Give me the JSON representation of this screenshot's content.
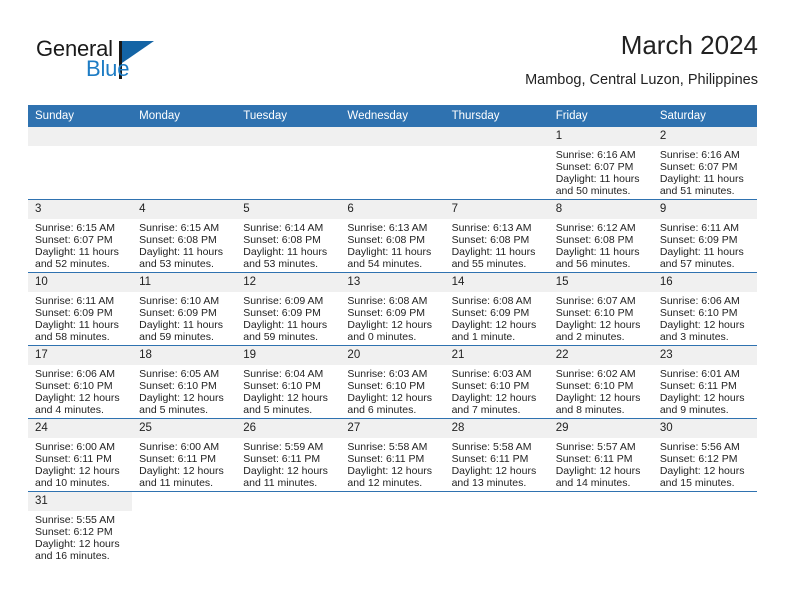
{
  "brand": {
    "name_part1": "General",
    "name_part2": "Blue",
    "triangle_color": "#1464a5",
    "blue_color": "#1d7cc4"
  },
  "header": {
    "title": "March 2024",
    "subtitle": "Mambog, Central Luzon, Philippines"
  },
  "theme": {
    "header_blue": "#2f72b0",
    "daynum_bg": "#f0f0f0",
    "text": "#232323"
  },
  "calendar": {
    "weekday_headers": [
      "Sunday",
      "Monday",
      "Tuesday",
      "Wednesday",
      "Thursday",
      "Friday",
      "Saturday"
    ],
    "weeks": [
      [
        {
          "day": "",
          "kind": "blank"
        },
        {
          "day": "",
          "kind": "blank"
        },
        {
          "day": "",
          "kind": "blank"
        },
        {
          "day": "",
          "kind": "blank"
        },
        {
          "day": "",
          "kind": "blank"
        },
        {
          "day": "1",
          "kind": "day",
          "sunrise": "Sunrise: 6:16 AM",
          "sunset": "Sunset: 6:07 PM",
          "daylight_line1": "Daylight: 11 hours",
          "daylight_line2": "and 50 minutes."
        },
        {
          "day": "2",
          "kind": "day",
          "sunrise": "Sunrise: 6:16 AM",
          "sunset": "Sunset: 6:07 PM",
          "daylight_line1": "Daylight: 11 hours",
          "daylight_line2": "and 51 minutes."
        }
      ],
      [
        {
          "day": "3",
          "kind": "day",
          "sunrise": "Sunrise: 6:15 AM",
          "sunset": "Sunset: 6:07 PM",
          "daylight_line1": "Daylight: 11 hours",
          "daylight_line2": "and 52 minutes."
        },
        {
          "day": "4",
          "kind": "day",
          "sunrise": "Sunrise: 6:15 AM",
          "sunset": "Sunset: 6:08 PM",
          "daylight_line1": "Daylight: 11 hours",
          "daylight_line2": "and 53 minutes."
        },
        {
          "day": "5",
          "kind": "day",
          "sunrise": "Sunrise: 6:14 AM",
          "sunset": "Sunset: 6:08 PM",
          "daylight_line1": "Daylight: 11 hours",
          "daylight_line2": "and 53 minutes."
        },
        {
          "day": "6",
          "kind": "day",
          "sunrise": "Sunrise: 6:13 AM",
          "sunset": "Sunset: 6:08 PM",
          "daylight_line1": "Daylight: 11 hours",
          "daylight_line2": "and 54 minutes."
        },
        {
          "day": "7",
          "kind": "day",
          "sunrise": "Sunrise: 6:13 AM",
          "sunset": "Sunset: 6:08 PM",
          "daylight_line1": "Daylight: 11 hours",
          "daylight_line2": "and 55 minutes."
        },
        {
          "day": "8",
          "kind": "day",
          "sunrise": "Sunrise: 6:12 AM",
          "sunset": "Sunset: 6:08 PM",
          "daylight_line1": "Daylight: 11 hours",
          "daylight_line2": "and 56 minutes."
        },
        {
          "day": "9",
          "kind": "day",
          "sunrise": "Sunrise: 6:11 AM",
          "sunset": "Sunset: 6:09 PM",
          "daylight_line1": "Daylight: 11 hours",
          "daylight_line2": "and 57 minutes."
        }
      ],
      [
        {
          "day": "10",
          "kind": "day",
          "sunrise": "Sunrise: 6:11 AM",
          "sunset": "Sunset: 6:09 PM",
          "daylight_line1": "Daylight: 11 hours",
          "daylight_line2": "and 58 minutes."
        },
        {
          "day": "11",
          "kind": "day",
          "sunrise": "Sunrise: 6:10 AM",
          "sunset": "Sunset: 6:09 PM",
          "daylight_line1": "Daylight: 11 hours",
          "daylight_line2": "and 59 minutes."
        },
        {
          "day": "12",
          "kind": "day",
          "sunrise": "Sunrise: 6:09 AM",
          "sunset": "Sunset: 6:09 PM",
          "daylight_line1": "Daylight: 11 hours",
          "daylight_line2": "and 59 minutes."
        },
        {
          "day": "13",
          "kind": "day",
          "sunrise": "Sunrise: 6:08 AM",
          "sunset": "Sunset: 6:09 PM",
          "daylight_line1": "Daylight: 12 hours",
          "daylight_line2": "and 0 minutes."
        },
        {
          "day": "14",
          "kind": "day",
          "sunrise": "Sunrise: 6:08 AM",
          "sunset": "Sunset: 6:09 PM",
          "daylight_line1": "Daylight: 12 hours",
          "daylight_line2": "and 1 minute."
        },
        {
          "day": "15",
          "kind": "day",
          "sunrise": "Sunrise: 6:07 AM",
          "sunset": "Sunset: 6:10 PM",
          "daylight_line1": "Daylight: 12 hours",
          "daylight_line2": "and 2 minutes."
        },
        {
          "day": "16",
          "kind": "day",
          "sunrise": "Sunrise: 6:06 AM",
          "sunset": "Sunset: 6:10 PM",
          "daylight_line1": "Daylight: 12 hours",
          "daylight_line2": "and 3 minutes."
        }
      ],
      [
        {
          "day": "17",
          "kind": "day",
          "sunrise": "Sunrise: 6:06 AM",
          "sunset": "Sunset: 6:10 PM",
          "daylight_line1": "Daylight: 12 hours",
          "daylight_line2": "and 4 minutes."
        },
        {
          "day": "18",
          "kind": "day",
          "sunrise": "Sunrise: 6:05 AM",
          "sunset": "Sunset: 6:10 PM",
          "daylight_line1": "Daylight: 12 hours",
          "daylight_line2": "and 5 minutes."
        },
        {
          "day": "19",
          "kind": "day",
          "sunrise": "Sunrise: 6:04 AM",
          "sunset": "Sunset: 6:10 PM",
          "daylight_line1": "Daylight: 12 hours",
          "daylight_line2": "and 5 minutes."
        },
        {
          "day": "20",
          "kind": "day",
          "sunrise": "Sunrise: 6:03 AM",
          "sunset": "Sunset: 6:10 PM",
          "daylight_line1": "Daylight: 12 hours",
          "daylight_line2": "and 6 minutes."
        },
        {
          "day": "21",
          "kind": "day",
          "sunrise": "Sunrise: 6:03 AM",
          "sunset": "Sunset: 6:10 PM",
          "daylight_line1": "Daylight: 12 hours",
          "daylight_line2": "and 7 minutes."
        },
        {
          "day": "22",
          "kind": "day",
          "sunrise": "Sunrise: 6:02 AM",
          "sunset": "Sunset: 6:10 PM",
          "daylight_line1": "Daylight: 12 hours",
          "daylight_line2": "and 8 minutes."
        },
        {
          "day": "23",
          "kind": "day",
          "sunrise": "Sunrise: 6:01 AM",
          "sunset": "Sunset: 6:11 PM",
          "daylight_line1": "Daylight: 12 hours",
          "daylight_line2": "and 9 minutes."
        }
      ],
      [
        {
          "day": "24",
          "kind": "day",
          "sunrise": "Sunrise: 6:00 AM",
          "sunset": "Sunset: 6:11 PM",
          "daylight_line1": "Daylight: 12 hours",
          "daylight_line2": "and 10 minutes."
        },
        {
          "day": "25",
          "kind": "day",
          "sunrise": "Sunrise: 6:00 AM",
          "sunset": "Sunset: 6:11 PM",
          "daylight_line1": "Daylight: 12 hours",
          "daylight_line2": "and 11 minutes."
        },
        {
          "day": "26",
          "kind": "day",
          "sunrise": "Sunrise: 5:59 AM",
          "sunset": "Sunset: 6:11 PM",
          "daylight_line1": "Daylight: 12 hours",
          "daylight_line2": "and 11 minutes."
        },
        {
          "day": "27",
          "kind": "day",
          "sunrise": "Sunrise: 5:58 AM",
          "sunset": "Sunset: 6:11 PM",
          "daylight_line1": "Daylight: 12 hours",
          "daylight_line2": "and 12 minutes."
        },
        {
          "day": "28",
          "kind": "day",
          "sunrise": "Sunrise: 5:58 AM",
          "sunset": "Sunset: 6:11 PM",
          "daylight_line1": "Daylight: 12 hours",
          "daylight_line2": "and 13 minutes."
        },
        {
          "day": "29",
          "kind": "day",
          "sunrise": "Sunrise: 5:57 AM",
          "sunset": "Sunset: 6:11 PM",
          "daylight_line1": "Daylight: 12 hours",
          "daylight_line2": "and 14 minutes."
        },
        {
          "day": "30",
          "kind": "day",
          "sunrise": "Sunrise: 5:56 AM",
          "sunset": "Sunset: 6:12 PM",
          "daylight_line1": "Daylight: 12 hours",
          "daylight_line2": "and 15 minutes."
        }
      ],
      [
        {
          "day": "31",
          "kind": "day",
          "sunrise": "Sunrise: 5:55 AM",
          "sunset": "Sunset: 6:12 PM",
          "daylight_line1": "Daylight: 12 hours",
          "daylight_line2": "and 16 minutes."
        },
        {
          "day": "",
          "kind": "void"
        },
        {
          "day": "",
          "kind": "void"
        },
        {
          "day": "",
          "kind": "void"
        },
        {
          "day": "",
          "kind": "void"
        },
        {
          "day": "",
          "kind": "void"
        },
        {
          "day": "",
          "kind": "void"
        }
      ]
    ]
  }
}
